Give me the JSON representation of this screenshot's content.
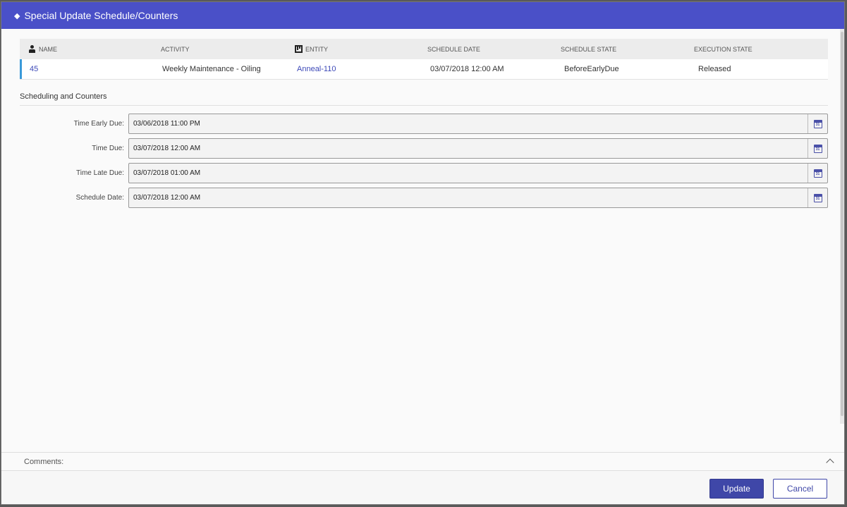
{
  "dialog": {
    "title": "Special Update Schedule/Counters"
  },
  "grid": {
    "headers": {
      "name": "NAME",
      "activity": "ACTIVITY",
      "entity": "ENTITY",
      "schedule_date": "SCHEDULE DATE",
      "schedule_state": "SCHEDULE STATE",
      "execution_state": "EXECUTION STATE"
    },
    "rows": [
      {
        "name": "45",
        "activity": "Weekly Maintenance - Oiling",
        "entity": "Anneal-110",
        "schedule_date": "03/07/2018 12:00 AM",
        "schedule_state": "BeforeEarlyDue",
        "execution_state": "Released"
      }
    ]
  },
  "section": {
    "title": "Scheduling and Counters"
  },
  "fields": [
    {
      "label": "Time Early Due:",
      "value": "03/06/2018 11:00 PM"
    },
    {
      "label": "Time Due:",
      "value": "03/07/2018 12:00 AM"
    },
    {
      "label": "Time Late Due:",
      "value": "03/07/2018 01:00 AM"
    },
    {
      "label": "Schedule Date:",
      "value": "03/07/2018 12:00 AM"
    }
  ],
  "calendar_icon_text": "31",
  "comments": {
    "label": "Comments:"
  },
  "buttons": {
    "update": "Update",
    "cancel": "Cancel"
  },
  "colors": {
    "titlebar": "#4a50c8",
    "primary_button": "#3f47a8",
    "link": "#3d49b8",
    "row_marker": "#3a9ad9"
  }
}
